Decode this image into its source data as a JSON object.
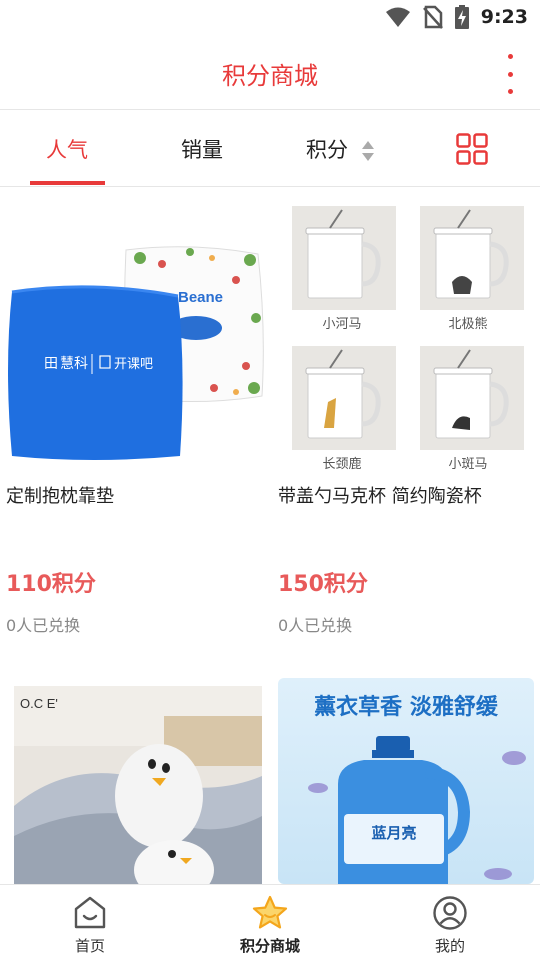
{
  "status_bar": {
    "time": "9:23"
  },
  "header": {
    "title": "积分商城"
  },
  "tabs": [
    {
      "label": "人气",
      "active": true
    },
    {
      "label": "销量",
      "active": false
    },
    {
      "label": "积分",
      "active": false
    }
  ],
  "products": [
    {
      "name": "定制抱枕靠垫",
      "price": "110积分",
      "exchanged": "0人已兑换",
      "image_text": {
        "brand_left": "慧科",
        "brand_right": "开课吧",
        "pillow_brand": "Beane"
      }
    },
    {
      "name": "带盖勺马克杯 简约陶瓷杯",
      "price": "150积分",
      "exchanged": "0人已兑换",
      "image_text": {
        "cup1": "小河马",
        "cup2": "北极熊",
        "cup3": "长颈鹿",
        "cup4": "小斑马"
      }
    },
    {
      "image_text": {
        "logo": "O.C E'"
      }
    },
    {
      "image_text": {
        "banner": "薰衣草香 淡雅舒缓",
        "bottle_brand": "蓝月亮"
      }
    }
  ],
  "bottom_nav": [
    {
      "label": "首页",
      "icon": "home-icon",
      "active": false
    },
    {
      "label": "积分商城",
      "icon": "star-icon",
      "active": true
    },
    {
      "label": "我的",
      "icon": "profile-icon",
      "active": false
    }
  ],
  "colors": {
    "accent": "#e83a3a",
    "price": "#e85a5a",
    "star": "#f4a61c"
  }
}
